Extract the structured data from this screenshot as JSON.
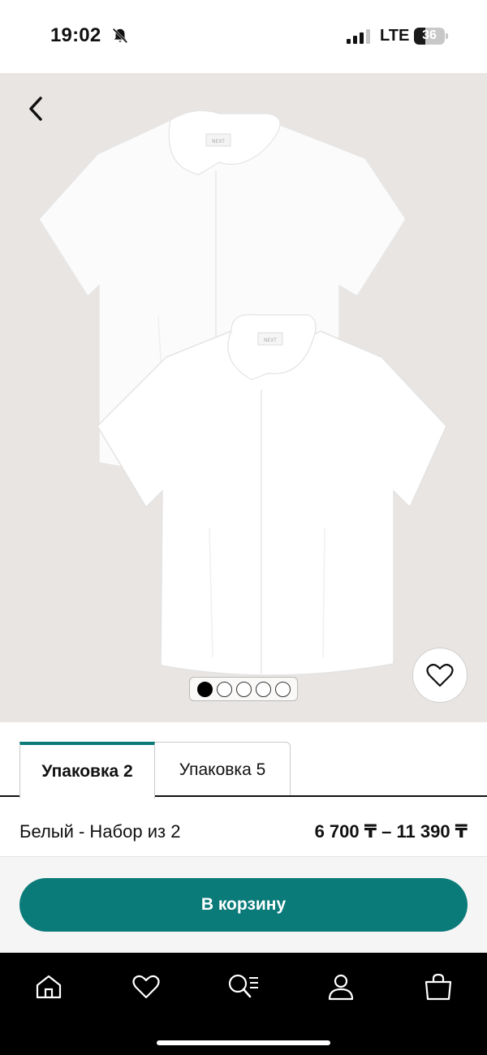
{
  "status_bar": {
    "time": "19:02",
    "network": "LTE",
    "battery": "36",
    "battery_level": 0.36,
    "icons": [
      "bell-slash-icon",
      "signal-icon",
      "battery-icon"
    ]
  },
  "gallery": {
    "back_icon": "chevron-left-icon",
    "wishlist_icon": "heart-icon",
    "image_count": 5,
    "active_image": 1,
    "background_color": "#e9e5e3",
    "shirt_tag_text": "NEXT"
  },
  "pack_tabs": [
    {
      "label": "Упаковка 2",
      "active": true
    },
    {
      "label": "Упаковка 5",
      "active": false
    }
  ],
  "variant": {
    "name": "Белый - Набор из 2",
    "price": "6 700 ₸ – 11 390 ₸"
  },
  "cart": {
    "add_label": "В корзину",
    "accent_color": "#0b7b7a"
  },
  "bottom_nav": {
    "items": [
      "home-icon",
      "heart-icon",
      "search-list-icon",
      "profile-icon",
      "bag-icon"
    ]
  }
}
